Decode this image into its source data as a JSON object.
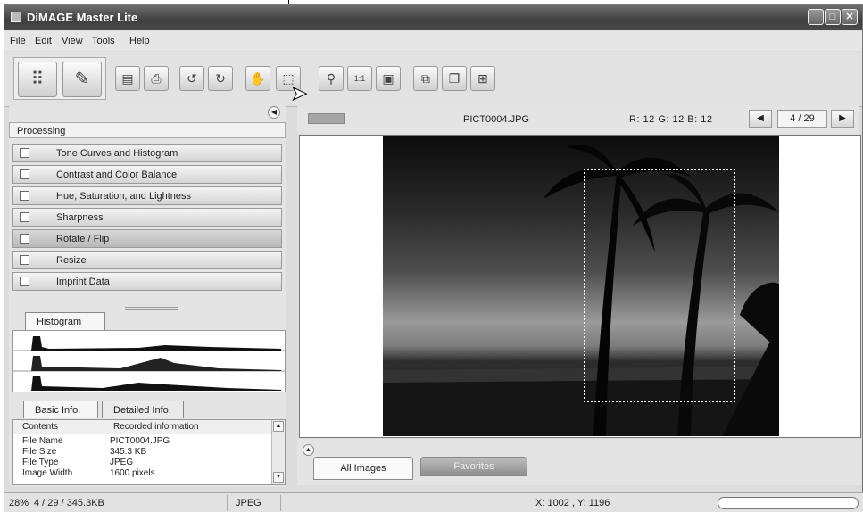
{
  "window": {
    "title": "DiMAGE Master Lite"
  },
  "menu": [
    "File",
    "Edit",
    "View",
    "Tools",
    "Help"
  ],
  "toolbar": {
    "icons": [
      "thumbnail-view-icon",
      "edit-view-icon",
      "save-icon",
      "print-icon",
      "rotate-left-icon",
      "rotate-right-icon",
      "hand-tool-icon",
      "crop-tool-icon",
      "zoom-icon",
      "actual-size-icon",
      "fit-window-icon",
      "compare-icon",
      "copy-icon",
      "slideshow-icon"
    ]
  },
  "processing": {
    "header": "Processing",
    "items": [
      {
        "label": "Tone Curves and Histogram",
        "active": false
      },
      {
        "label": "Contrast and Color Balance",
        "active": false
      },
      {
        "label": "Hue, Saturation, and Lightness",
        "active": false
      },
      {
        "label": "Sharpness",
        "active": false
      },
      {
        "label": "Rotate / Flip",
        "active": true
      },
      {
        "label": "Resize",
        "active": false
      },
      {
        "label": "Imprint Data",
        "active": false
      }
    ]
  },
  "histogram": {
    "tab": "Histogram"
  },
  "info": {
    "tabs": [
      "Basic Info.",
      "Detailed Info."
    ],
    "columns": [
      "Contents",
      "Recorded information"
    ],
    "rows": [
      [
        "File Name",
        "PICT0004.JPG"
      ],
      [
        "File Size",
        "345.3 KB"
      ],
      [
        "File Type",
        "JPEG"
      ],
      [
        "Image Width",
        "1600 pixels"
      ]
    ]
  },
  "viewer": {
    "filename": "PICT0004.JPG",
    "rgb": "R:  12  G:  12  B:  12",
    "page": "4 / 29"
  },
  "bottom_tabs": {
    "all": "All Images",
    "favorites": "Favorites"
  },
  "status": {
    "zoom": "28%",
    "info": "4 / 29 / 345.3KB",
    "type": "JPEG",
    "coords": "X: 1002 , Y: 1196"
  }
}
